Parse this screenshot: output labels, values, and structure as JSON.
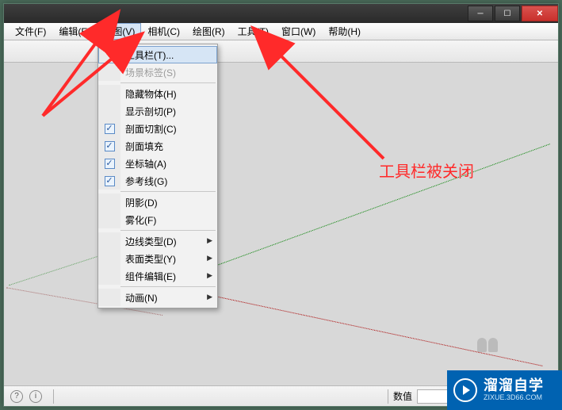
{
  "menubar": [
    {
      "label": "文件(F)"
    },
    {
      "label": "编辑(E)"
    },
    {
      "label": "视图(V)"
    },
    {
      "label": "相机(C)"
    },
    {
      "label": "绘图(R)"
    },
    {
      "label": "工具(T)"
    },
    {
      "label": "窗口(W)"
    },
    {
      "label": "帮助(H)"
    }
  ],
  "dropdown": {
    "groups": [
      [
        {
          "label": "工具栏(T)...",
          "highlight": true
        },
        {
          "label": "场景标签(S)",
          "disabled": true
        }
      ],
      [
        {
          "label": "隐藏物体(H)"
        },
        {
          "label": "显示剖切(P)"
        },
        {
          "label": "剖面切割(C)",
          "checked": true
        },
        {
          "label": "剖面填充",
          "checked": true
        },
        {
          "label": "坐标轴(A)",
          "checked": true
        },
        {
          "label": "参考线(G)",
          "checked": true
        }
      ],
      [
        {
          "label": "阴影(D)"
        },
        {
          "label": "雾化(F)"
        }
      ],
      [
        {
          "label": "边线类型(D)",
          "submenu": true
        },
        {
          "label": "表面类型(Y)",
          "submenu": true
        },
        {
          "label": "组件编辑(E)",
          "submenu": true
        }
      ],
      [
        {
          "label": "动画(N)",
          "submenu": true
        }
      ]
    ]
  },
  "status": {
    "value_label": "数值"
  },
  "annotation": {
    "text": "工具栏被关闭"
  },
  "watermark": {
    "main": "溜溜自学",
    "sub": "ZIXUE.3D66.COM"
  },
  "window_controls": {
    "min": "─",
    "max": "☐",
    "close": "✕"
  }
}
